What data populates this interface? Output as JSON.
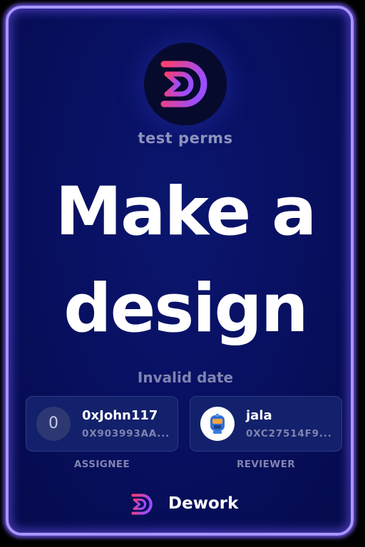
{
  "org": {
    "name": "test perms"
  },
  "task": {
    "title_line1": "Make a",
    "title_line2": "design",
    "due_date": "Invalid date"
  },
  "assignee": {
    "avatar_initial": "0",
    "name": "0xJohn117",
    "address": "0X903993AA...",
    "role_label": "ASSIGNEE"
  },
  "reviewer": {
    "avatar_icon": "helmet-avatar-icon",
    "name": "jala",
    "address": "0XC27514F9...",
    "role_label": "REVIEWER"
  },
  "brand": {
    "name": "Dework",
    "logo_icon": "dework-logo-icon"
  },
  "colors": {
    "card_border": "#a995ff",
    "card_background": "#081062",
    "logo_gradient_start": "#ff3d6a",
    "logo_gradient_end": "#9b4dff",
    "muted_text": "#7f84b0"
  }
}
